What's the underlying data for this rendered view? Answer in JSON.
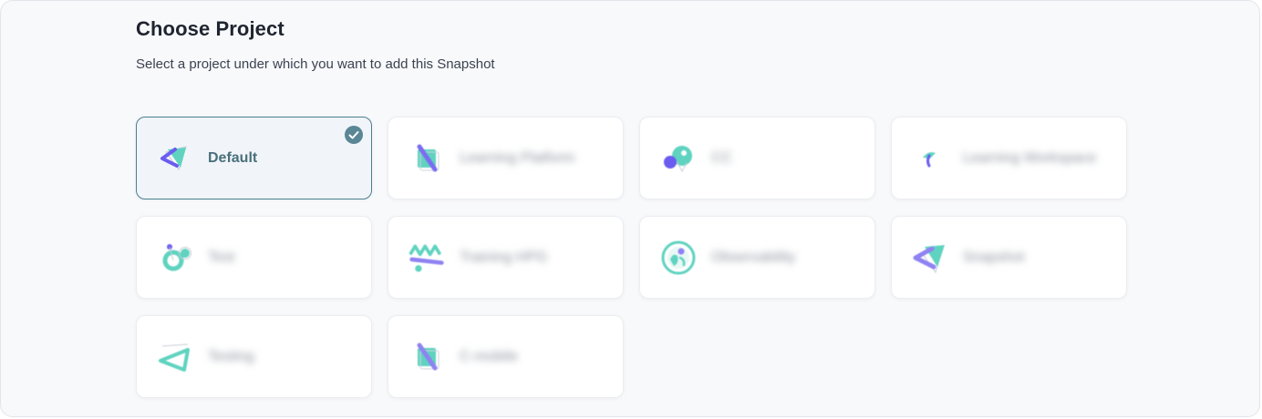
{
  "header": {
    "title": "Choose Project",
    "subtitle": "Select a project under which you want to add this Snapshot"
  },
  "colors": {
    "accent_teal": "#5fd3c0",
    "accent_purple": "#7b6cf0",
    "selected_border": "#4a7f8f",
    "check_fill": "#5a8696"
  },
  "projects": [
    {
      "label": "Default",
      "icon": "arrow-triangle-icon",
      "selected": true
    },
    {
      "label": "Learning Platform",
      "icon": "slash-square-icon",
      "selected": false
    },
    {
      "label": "CC",
      "icon": "circle-pin-icon",
      "selected": false
    },
    {
      "label": "Learning Workspace",
      "icon": "leaf-mark-icon",
      "selected": false
    },
    {
      "label": "Test",
      "icon": "orbit-dots-icon",
      "selected": false
    },
    {
      "label": "Training HPG",
      "icon": "zigzag-icon",
      "selected": false
    },
    {
      "label": "Observability",
      "icon": "planet-icon",
      "selected": false
    },
    {
      "label": "Snapshot",
      "icon": "arrow-triangle-icon",
      "selected": false
    },
    {
      "label": "Testing",
      "icon": "triangle-outline-icon",
      "selected": false
    },
    {
      "label": "C-mobile",
      "icon": "slash-square-icon",
      "selected": false
    }
  ]
}
